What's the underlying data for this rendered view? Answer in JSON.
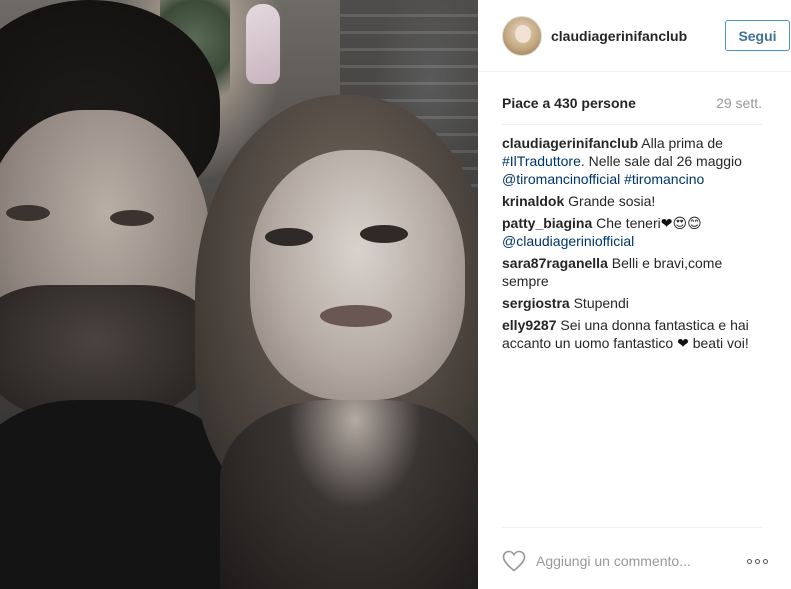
{
  "header": {
    "username": "claudiagerinifanclub",
    "follow_label": "Segui"
  },
  "stats": {
    "likes_text": "Piace a 430 persone",
    "date": "29 sett."
  },
  "comments": [
    {
      "user": "claudiagerinifanclub",
      "parts": [
        {
          "text": "Alla prima de ",
          "kind": "text"
        },
        {
          "text": "#IlTraduttore",
          "kind": "tag"
        },
        {
          "text": ". Nelle sale dal 26 maggio ",
          "kind": "text"
        },
        {
          "text": "@tiromancinofficial",
          "kind": "tag"
        },
        {
          "text": " ",
          "kind": "text"
        },
        {
          "text": "#tiromancino",
          "kind": "tag"
        }
      ]
    },
    {
      "user": "krinaldok",
      "parts": [
        {
          "text": "Grande sosia!",
          "kind": "text"
        }
      ]
    },
    {
      "user": "patty_biagina",
      "parts": [
        {
          "text": "Che teneri",
          "kind": "text"
        },
        {
          "text": "❤",
          "kind": "heart"
        },
        {
          "text": "😍",
          "kind": "emoji-heart-eyes"
        },
        {
          "text": "😊",
          "kind": "emoji-smile"
        },
        {
          "text": "@claudiagerinio fficial",
          "kind": "tag-hidden"
        }
      ]
    },
    {
      "user": "sara87raganella",
      "parts": [
        {
          "text": "Belli e bravi,come sempre",
          "kind": "text"
        }
      ]
    },
    {
      "user": "sergiostra",
      "parts": [
        {
          "text": "Stupendi",
          "kind": "text"
        }
      ]
    },
    {
      "user": "elly9287",
      "parts": [
        {
          "text": "Sei una donna fantastica e hai accanto un uomo fantastico ",
          "kind": "text"
        },
        {
          "text": "❤",
          "kind": "heart"
        },
        {
          "text": " beati voi!",
          "kind": "text"
        }
      ]
    }
  ],
  "comment_box": {
    "placeholder": "Aggiungi un commento...",
    "like_icon": "heart-outline-icon",
    "more_icon": "more-options-icon"
  },
  "colors": {
    "link": "#003569",
    "follow_border": "#4d90c7",
    "follow_text": "#3f729b",
    "muted": "#999999"
  }
}
